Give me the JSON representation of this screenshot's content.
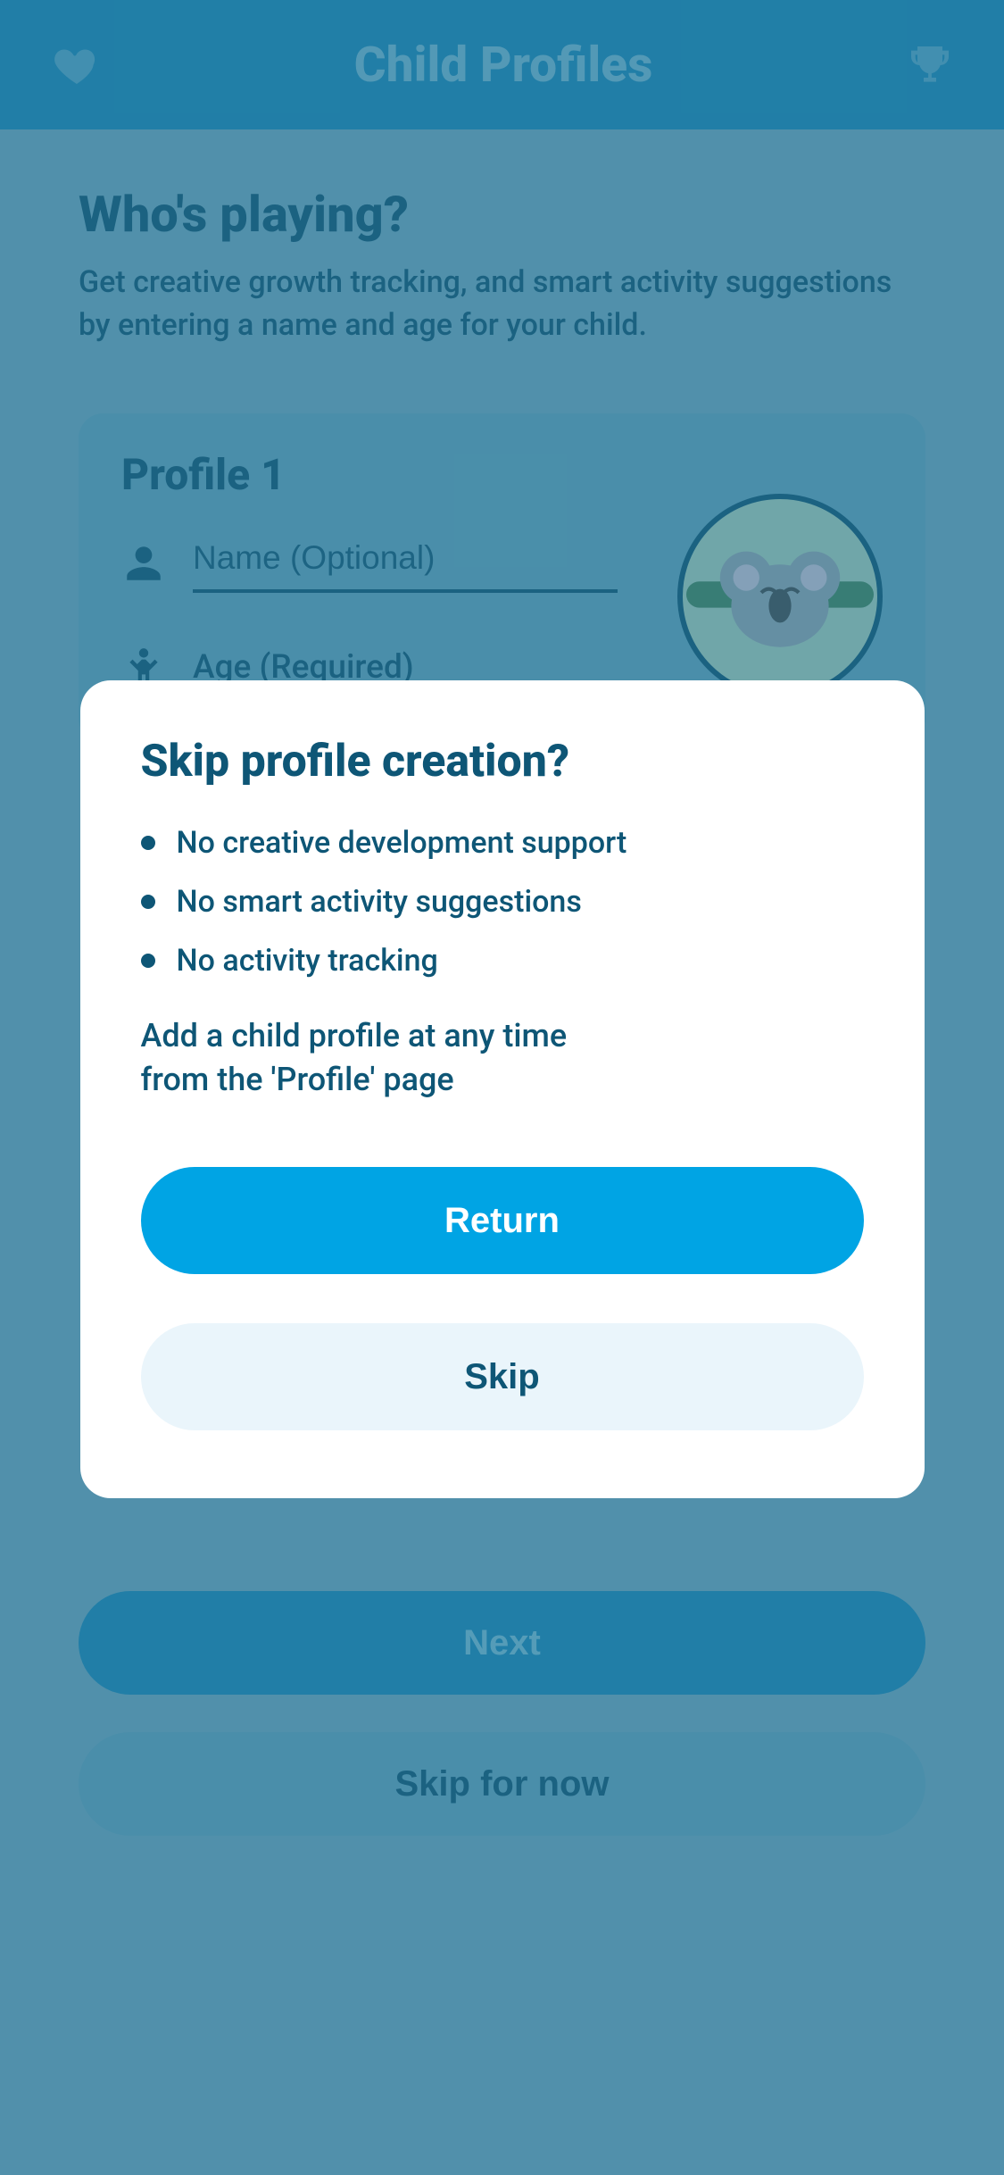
{
  "header": {
    "title": "Child Profiles"
  },
  "page": {
    "heading": "Who's playing?",
    "subheading": "Get creative growth tracking, and smart activity suggestions by entering a name and age for your child."
  },
  "profile": {
    "card_title": "Profile 1",
    "name_placeholder": "Name (Optional)",
    "name_value": "",
    "age_label": "Age (Required)"
  },
  "buttons": {
    "next": "Next",
    "skip_for_now": "Skip for now"
  },
  "modal": {
    "title": "Skip profile creation?",
    "items": [
      "No creative development support",
      "No smart activity suggestions",
      "No activity tracking"
    ],
    "note": "Add a child profile at any time from the 'Profile' page",
    "return_label": "Return",
    "skip_label": "Skip"
  }
}
